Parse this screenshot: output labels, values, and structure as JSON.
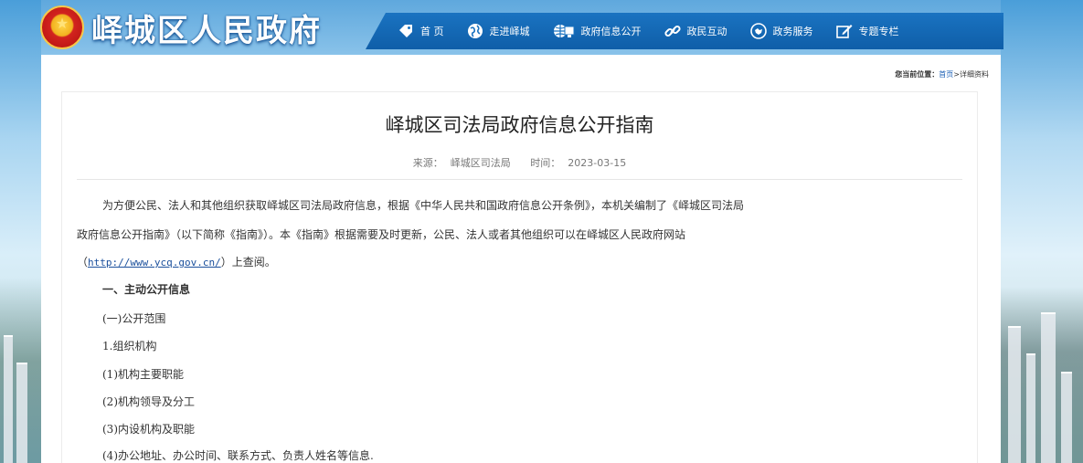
{
  "header": {
    "site_title": "峄城区人民政府",
    "nav": [
      {
        "label": "首 页",
        "icon": "tag-icon"
      },
      {
        "label": "走进峄城",
        "icon": "globe-icon"
      },
      {
        "label": "政府信息公开",
        "icon": "globe-screen-icon"
      },
      {
        "label": "政民互动",
        "icon": "link-icon"
      },
      {
        "label": "政务服务",
        "icon": "handshake-icon"
      },
      {
        "label": "专题专栏",
        "icon": "edit-icon"
      }
    ]
  },
  "breadcrumb": {
    "prefix": "您当前位置：",
    "home": "首页",
    "separator": ">",
    "current": "详细资料"
  },
  "article": {
    "title": "峄城区司法局政府信息公开指南",
    "source_label": "来源：",
    "source": "峄城区司法局",
    "time_label": "时间：",
    "time": "2023-03-15",
    "intro_line1": "为方便公民、法人和其他组织获取峄城区司法局政府信息，根据《中华人民共和国政府信息公开条例》，本机关编制了《峄城区司法局",
    "intro_line2": "政府信息公开指南》（以下简称《指南》）。本《指南》根据需要及时更新，公民、法人或者其他组织可以在峄城区人民政府网站",
    "intro_line3_open": "（",
    "intro_link": "http://www.ycq.gov.cn/",
    "intro_line3_close": "）上查阅。",
    "section1": "一、主动公开信息",
    "sub1": "(一)公开范围",
    "item1": "1.组织机构",
    "item1_1": "(1)机构主要职能",
    "item1_2": "(2)机构领导及分工",
    "item1_3": "(3)内设机构及职能",
    "item1_4": "(4)办公地址、办公时间、联系方式、负责人姓名等信息."
  },
  "colors": {
    "nav_bg": "#1a73c1",
    "link": "#1a4f9c"
  }
}
